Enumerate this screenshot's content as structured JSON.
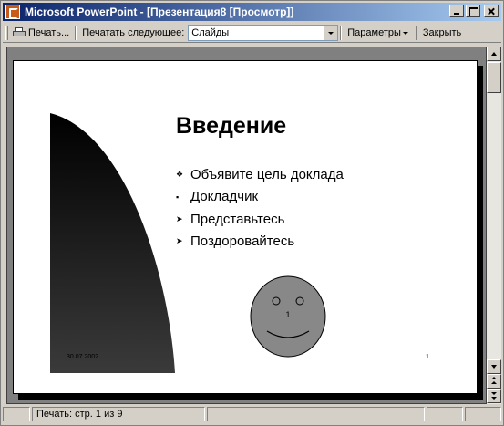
{
  "window": {
    "title": "Microsoft PowerPoint - [Презентация8 [Просмотр]]"
  },
  "toolbar": {
    "print_label": "Печать...",
    "print_what_label": "Печатать следующее:",
    "print_what_value": "Слайды",
    "options_label": "Параметры",
    "close_label": "Закрыть"
  },
  "slide": {
    "title": "Введение",
    "bullets": [
      {
        "marker": "❖",
        "text": "Объявите цель доклада"
      },
      {
        "marker": "▪",
        "text": "Докладчик"
      },
      {
        "marker": "➤",
        "text": "Представьтесь"
      },
      {
        "marker": "➤",
        "text": "Поздоровайтесь"
      }
    ],
    "smiley_label": "1",
    "footer_date": "30.07.2002",
    "footer_page_number": "1"
  },
  "status": {
    "page_text": "Печать: стр. 1 из 9"
  },
  "colors": {
    "titlebar_start": "#0a246a",
    "titlebar_end": "#a6caf0",
    "smiley_fill": "#888888"
  }
}
